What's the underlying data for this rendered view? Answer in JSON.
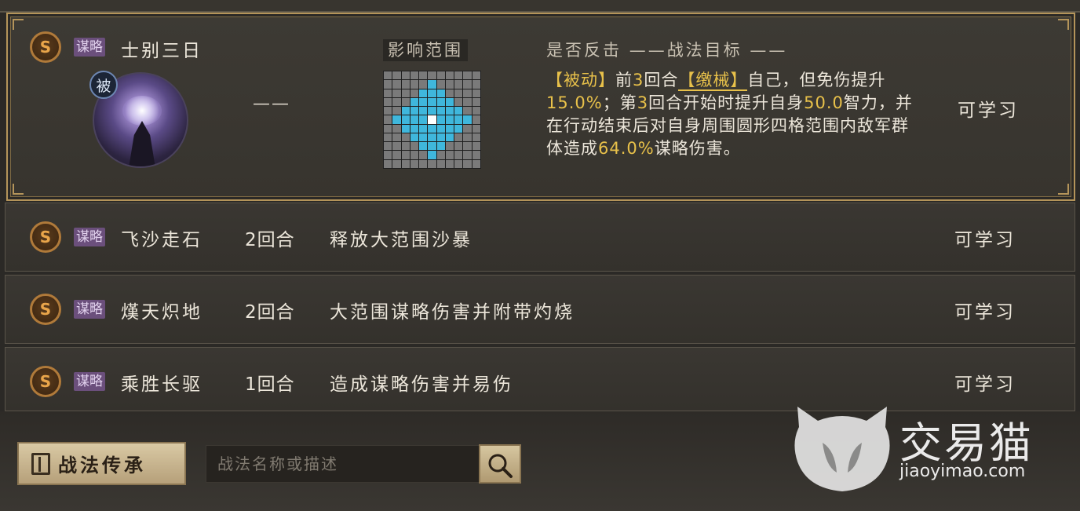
{
  "headers": {
    "range": "影响范围",
    "counter": "是否反击",
    "target": "战法目标",
    "target_dash": "——"
  },
  "selected": {
    "grade": "S",
    "type": "谋略",
    "name": "士别三日",
    "passive_badge": "被",
    "rounds": "——",
    "desc": {
      "tag1": "【被动】",
      "t1": "前",
      "n1": "3",
      "t2": "回合",
      "tag2": "【缴械】",
      "t3": "自己，但免伤提升",
      "n2": "15.0%",
      "t4": "；第",
      "n3": "3",
      "t5": "回合开始时提升自身",
      "n4": "50.0",
      "t6": "智力，并在行动结束后对自身周围圆形四格范围内敌军群体造成",
      "n5": "64.0%",
      "t7": "谋略伤害。"
    },
    "action": "可学习"
  },
  "skills": [
    {
      "grade": "S",
      "type": "谋略",
      "name": "飞沙走石",
      "rounds": "2回合",
      "desc": "释放大范围沙暴",
      "action": "可学习"
    },
    {
      "grade": "S",
      "type": "谋略",
      "name": "熯天炽地",
      "rounds": "2回合",
      "desc": "大范围谋略伤害并附带灼烧",
      "action": "可学习"
    },
    {
      "grade": "S",
      "type": "谋略",
      "name": "乘胜长驱",
      "rounds": "1回合",
      "desc": "造成谋略伤害并易伤",
      "action": "可学习"
    }
  ],
  "footer": {
    "inherit_label": "战法传承",
    "search_placeholder": "战法名称或描述"
  },
  "watermark": {
    "brand": "交易猫",
    "url": "jiaoyimao.com"
  },
  "colors": {
    "frame_gold": "#b4945a",
    "highlight": "#e8c14a",
    "range_cell": "#3fb7dc",
    "type_tag": "#6b4f7c"
  }
}
